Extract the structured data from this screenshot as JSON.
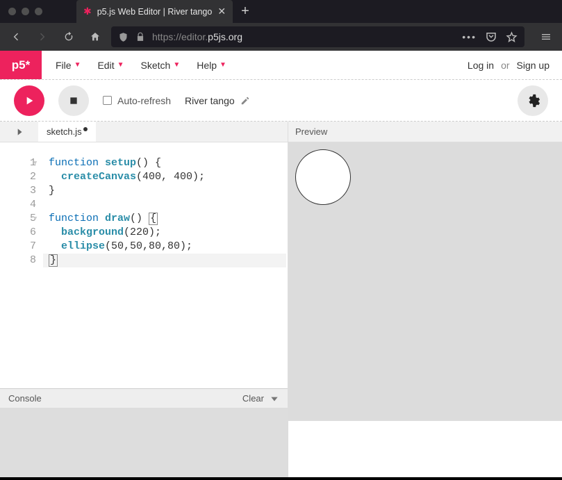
{
  "browser": {
    "tab_title": "p5.js Web Editor | River tango",
    "url_prefix": "https://editor.",
    "url_domain": "p5js.org"
  },
  "logo": "p5*",
  "menus": {
    "file": "File",
    "edit": "Edit",
    "sketch": "Sketch",
    "help": "Help"
  },
  "auth": {
    "login": "Log in",
    "or": "or",
    "signup": "Sign up"
  },
  "toolbar": {
    "auto_refresh": "Auto-refresh",
    "sketch_name": "River tango"
  },
  "editor": {
    "filename": "sketch.js",
    "line_numbers": [
      "1",
      "2",
      "3",
      "4",
      "5",
      "6",
      "7",
      "8"
    ]
  },
  "code": {
    "l1_kw": "function",
    "l1_fn": "setup",
    "l1_rest": "() {",
    "l2_fn": "createCanvas",
    "l2_args": "(400, 400);",
    "l3": "}",
    "l5_kw": "function",
    "l5_fn": "draw",
    "l5_p": "() ",
    "l5_brace": "{",
    "l6_fn": "background",
    "l6_args": "(220);",
    "l7_fn": "ellipse",
    "l7_args": "(50,50,80,80);",
    "l8": "}"
  },
  "console": {
    "title": "Console",
    "clear": "Clear"
  },
  "preview": {
    "title": "Preview"
  }
}
